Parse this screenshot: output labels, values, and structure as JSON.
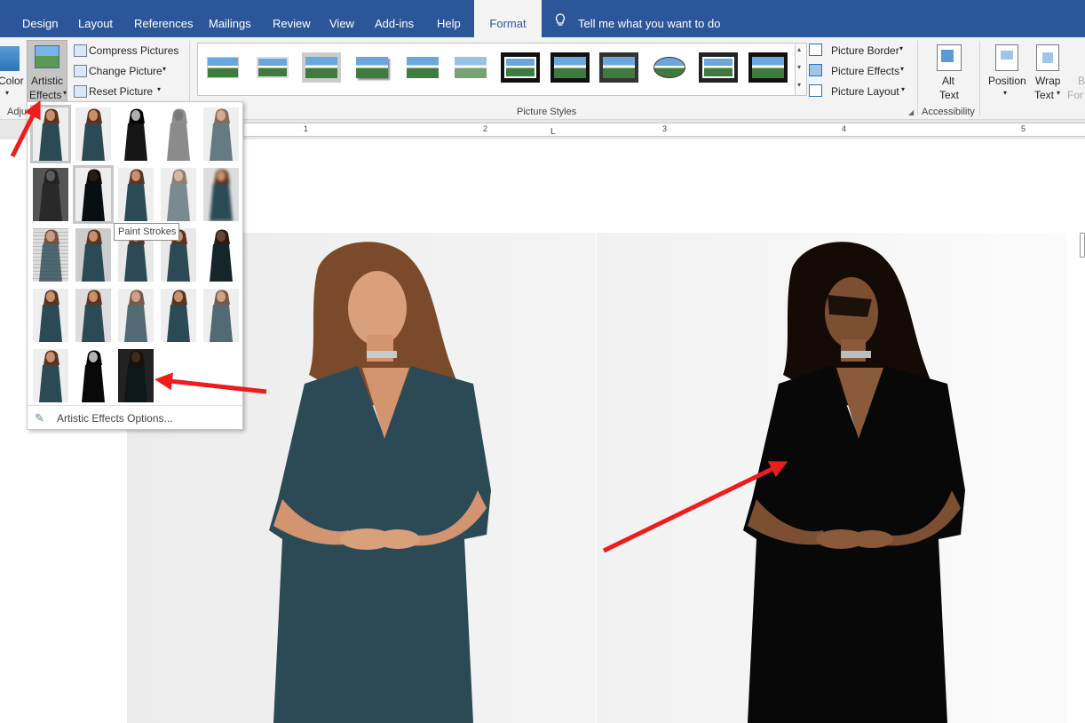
{
  "tabs": [
    "Design",
    "Layout",
    "References",
    "Mailings",
    "Review",
    "View",
    "Add-ins",
    "Help",
    "Format"
  ],
  "active_tab": "Format",
  "tell_me": "Tell me what you want to do",
  "adjust": {
    "color_label": "Color",
    "artistic_label_1": "Artistic",
    "artistic_label_2": "Effects",
    "compress": "Compress Pictures",
    "change": "Change Picture",
    "reset": "Reset Picture",
    "group": "Adjust"
  },
  "picture_styles": {
    "group": "Picture Styles",
    "border": "Picture Border",
    "effects": "Picture Effects",
    "layout": "Picture Layout"
  },
  "accessibility": {
    "alt_1": "Alt",
    "alt_2": "Text",
    "group": "Accessibility"
  },
  "arrange": {
    "position": "Position",
    "wrap_1": "Wrap",
    "wrap_2": "Text",
    "bring_1": "B",
    "bring_2": "For"
  },
  "ruler_numbers": [
    "1",
    "2",
    "3",
    "4",
    "5"
  ],
  "dropdown": {
    "tooltip": "Paint Strokes",
    "options": "Artistic Effects Options..."
  },
  "colors": {
    "ribbon_blue": "#2b579a",
    "arrow_red": "#ee1c1c",
    "dress_teal": "#2c4a55"
  }
}
